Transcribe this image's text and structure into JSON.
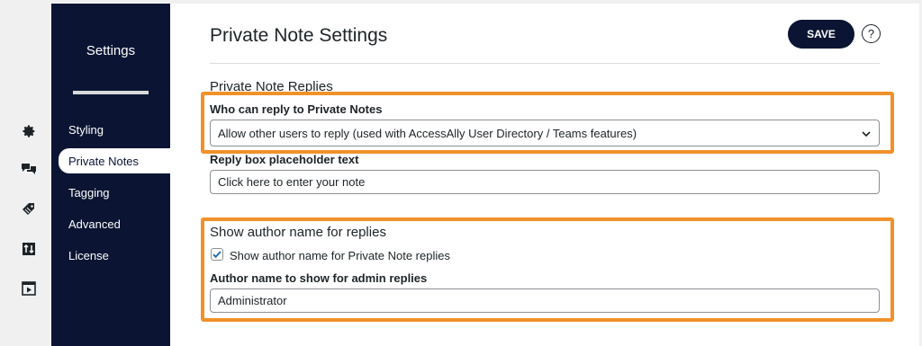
{
  "rail": {
    "icons": [
      "gear-icon",
      "chat-bubbles-icon",
      "tag-icon",
      "sort-icon",
      "media-player-icon"
    ]
  },
  "sidebar": {
    "title": "Settings",
    "items": [
      {
        "label": "Styling"
      },
      {
        "label": "Private Notes"
      },
      {
        "label": "Tagging"
      },
      {
        "label": "Advanced"
      },
      {
        "label": "License"
      }
    ],
    "active_item": "Private Notes"
  },
  "main": {
    "title": "Private Note Settings",
    "save_label": "SAVE",
    "help_label": "?",
    "replies_section": {
      "heading": "Private Note Replies",
      "who_can_reply_label": "Who can reply to Private Notes",
      "who_can_reply_value": "Allow other users to reply (used with AccessAlly User Directory / Teams features)",
      "placeholder_label": "Reply box placeholder text",
      "placeholder_value": "Click here to enter your note"
    },
    "author_section": {
      "heading": "Show author name for replies",
      "checkbox_label": "Show author name for Private Note replies",
      "checkbox_checked": true,
      "admin_name_label": "Author name to show for admin replies",
      "admin_name_value": "Administrator"
    }
  },
  "colors": {
    "sidebar_bg": "#0b1533",
    "accent_highlight": "#f0912a",
    "checkbox_check": "#2271b1"
  }
}
